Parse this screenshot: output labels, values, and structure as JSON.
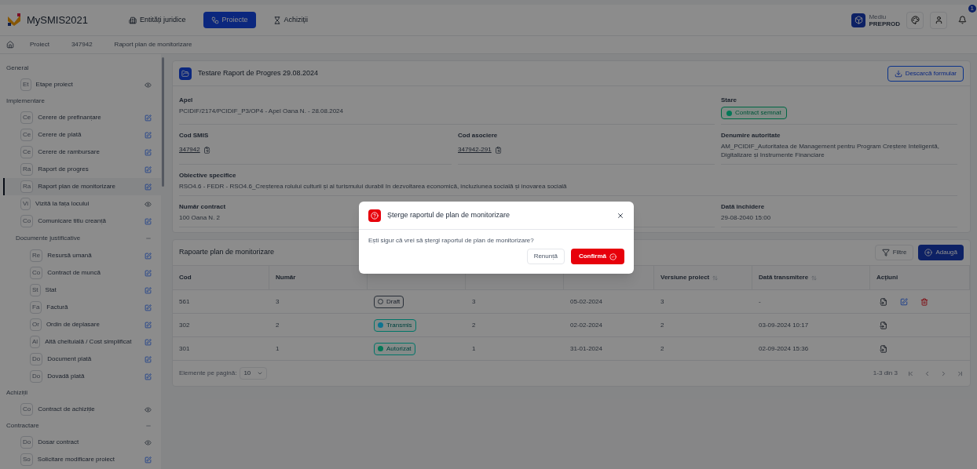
{
  "header": {
    "app_name": "MySMIS2021",
    "nav": [
      {
        "label": "Entități juridice",
        "selected": false
      },
      {
        "label": "Proiecte",
        "selected": true
      },
      {
        "label": "Achiziții",
        "selected": false
      }
    ],
    "environment": {
      "label": "Mediu",
      "value": "PREPROD"
    },
    "notifications_badge": "1"
  },
  "breadcrumb": [
    "Proiect",
    "347942",
    "Raport plan de monitorizare"
  ],
  "sidebar": {
    "sections": [
      {
        "title": "General",
        "items": [
          {
            "abbr": "Et",
            "label": "Etape proiect",
            "kind": "view",
            "selected": false
          }
        ]
      },
      {
        "title": "Implementare",
        "items": [
          {
            "abbr": "Ce",
            "label": "Cerere de prefinanțare",
            "kind": "edit",
            "selected": false
          },
          {
            "abbr": "Ce",
            "label": "Cerere de plată",
            "kind": "edit",
            "selected": false
          },
          {
            "abbr": "Ce",
            "label": "Cerere de rambursare",
            "kind": "edit",
            "selected": false
          },
          {
            "abbr": "Ra",
            "label": "Raport de progres",
            "kind": "edit",
            "selected": false
          },
          {
            "abbr": "Ra",
            "label": "Raport plan de monitorizare",
            "kind": "edit",
            "selected": true
          },
          {
            "abbr": "Vi",
            "label": "Vizită la fața locului",
            "kind": "view",
            "selected": false
          },
          {
            "abbr": "Co",
            "label": "Comunicare titlu creanță",
            "kind": "edit",
            "selected": false
          },
          {
            "label": "Documente justificative",
            "kind": "group",
            "expanded": true,
            "children": [
              {
                "abbr": "Re",
                "label": "Resursă umană",
                "kind": "edit",
                "selected": false
              },
              {
                "abbr": "Co",
                "label": "Contract de muncă",
                "kind": "edit",
                "selected": false
              },
              {
                "abbr": "St",
                "label": "Stat",
                "kind": "edit",
                "selected": false
              },
              {
                "abbr": "Fa",
                "label": "Factură",
                "kind": "edit",
                "selected": false
              },
              {
                "abbr": "Or",
                "label": "Ordin de deplasare",
                "kind": "edit",
                "selected": false
              },
              {
                "abbr": "Al",
                "label": "Altă cheltuială / Cost simplificat",
                "kind": "edit",
                "selected": false
              },
              {
                "abbr": "Do",
                "label": "Document plată",
                "kind": "edit",
                "selected": false
              },
              {
                "abbr": "Do",
                "label": "Dovadă plată",
                "kind": "edit",
                "selected": false
              }
            ]
          }
        ]
      },
      {
        "title": "Achiziții",
        "items": [
          {
            "abbr": "Co",
            "label": "Contract de achiziție",
            "kind": "view",
            "selected": false
          }
        ]
      },
      {
        "title": "Contractare",
        "expanded": true,
        "items": [
          {
            "abbr": "Do",
            "label": "Dosar contract",
            "kind": "view",
            "selected": false
          },
          {
            "abbr": "So",
            "label": "Solicitare modificare proiect",
            "kind": "edit",
            "selected": false
          }
        ]
      }
    ]
  },
  "details": {
    "title": "Testare Raport de Progres 29.08.2024",
    "download_button": "Descarcă formular",
    "rows": [
      [
        {
          "label": "Apel",
          "kind": "text",
          "value": "PCIDIF/2174/PCIDIF_P3/OP4 - Apel Oana N. - 28.08.2024"
        },
        {
          "label": "Stare",
          "kind": "badge",
          "value": "Contract semnat",
          "color": "#047857"
        }
      ],
      [
        {
          "label": "Cod SMIS",
          "kind": "link",
          "value": "347942"
        },
        {
          "label": "Cod asociere",
          "kind": "link",
          "value": "347942-291"
        },
        {
          "label": "Denumire autoritate",
          "kind": "text",
          "value": "AM_PCIDIF_Autoritatea de Management pentru Program Creștere Inteligentă, Digitalizare și Instrumente Financiare"
        }
      ],
      [
        {
          "label": "Obiective specifice",
          "kind": "text",
          "value": "RSO4.6 - FEDR - RSO4.6_Creșterea rolului culturii și al turismului durabil în dezvoltarea economică, incluziunea socială și inovarea socială"
        }
      ],
      [
        {
          "label": "Număr contract",
          "kind": "text",
          "value": "100 Oana N. 2"
        },
        {
          "label": "Dată închidere",
          "kind": "text",
          "value": "29-08-2040 15:00"
        }
      ]
    ]
  },
  "reports": {
    "title": "Rapoarte plan de monitorizare",
    "filter_button": "Filtre",
    "add_button": "Adaugă",
    "columns": [
      {
        "label": "Cod"
      },
      {
        "label": "Număr"
      },
      {},
      {},
      {},
      {
        "label": "Versiune proiect",
        "sortable": true
      },
      {
        "label": "Dată transmitere",
        "sortable": true
      },
      {
        "label": "Acțiuni"
      }
    ],
    "rows": [
      {
        "cells": [
          "561",
          "3",
          {
            "label": "Draft",
            "kind": "hollow"
          },
          "3",
          "05-02-2024",
          "3",
          "-"
        ],
        "actions": [
          {
            "kind": "view"
          },
          {
            "kind": "edit"
          },
          {
            "kind": "delete"
          }
        ]
      },
      {
        "cells": [
          "302",
          "2",
          {
            "label": "Transmis",
            "kind": "dot",
            "color": "#0e7490"
          },
          "2",
          "02-02-2024",
          "2",
          "03-09-2024 10:17"
        ],
        "actions": [
          {
            "kind": "view"
          }
        ]
      },
      {
        "cells": [
          "301",
          "1",
          {
            "label": "Autorizat",
            "kind": "dot",
            "color": "#047857"
          },
          "1",
          "31-01-2024",
          "2",
          "02-09-2024 15:36"
        ],
        "actions": [
          {
            "kind": "view"
          }
        ]
      }
    ],
    "page_size_label": "Elemente pe pagină:",
    "page_size": "10",
    "range": "1-3 din 3"
  },
  "dialog": {
    "title": "Șterge raportul de plan de monitorizare",
    "message": "Ești sigur că vrei să ștergi raportul de plan de monitorizare?",
    "cancel": "Renunță",
    "confirm": "Confirmă"
  }
}
